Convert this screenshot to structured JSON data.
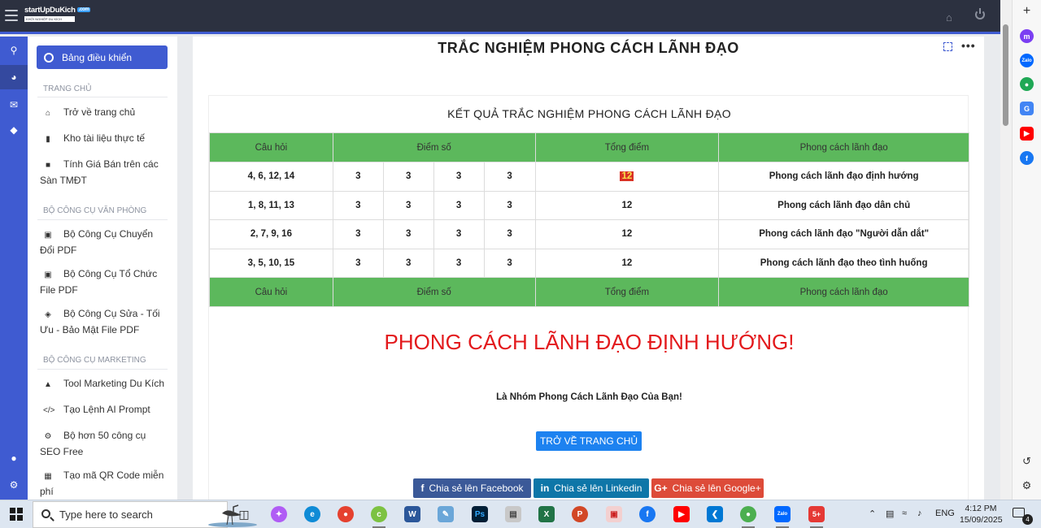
{
  "header": {
    "logo_text": "startUpDuKich",
    "logo_badge": ".com",
    "logo_tagline": "KHỞI NGHIỆP DU KÍCH"
  },
  "sidebar": {
    "dashboard_label": "Bảng điều khiển",
    "sections": [
      {
        "title": "TRANG CHỦ",
        "items": [
          {
            "label": "Trở về trang chủ",
            "icon": "home-icon"
          },
          {
            "label": "Kho tài liệu thực tế",
            "icon": "document-icon"
          },
          {
            "label": "Tính Giá Bán trên các Sàn TMĐT",
            "icon": "cart-icon"
          }
        ]
      },
      {
        "title": "BỘ CÔNG CỤ VĂN PHÒNG",
        "items": [
          {
            "label": "Bộ Công Cụ Chuyển Đổi PDF",
            "icon": "pdf-icon"
          },
          {
            "label": "Bộ Công Cụ Tổ Chức File PDF",
            "icon": "pdf-icon"
          },
          {
            "label": "Bộ Công Cụ Sửa - Tối Ưu - Bảo Mật File PDF",
            "icon": "shield-icon"
          }
        ]
      },
      {
        "title": "BỘ CÔNG CỤ MARKETING",
        "items": [
          {
            "label": "Tool Marketing Du Kích",
            "icon": "megaphone-icon"
          },
          {
            "label": "Tạo Lệnh AI Prompt",
            "icon": "code-icon"
          },
          {
            "label": "Bộ hơn 50 công cụ SEO Free",
            "icon": "gear-icon"
          },
          {
            "label": "Tạo mã QR Code miễn phí",
            "icon": "qrcode-icon"
          }
        ]
      }
    ]
  },
  "main": {
    "title": "TRẮC NGHIỆM PHONG CÁCH LÃNH ĐẠO",
    "result_title": "KẾT QUẢ TRẮC NGHIỆM PHONG CÁCH LÃNH ĐẠO",
    "table": {
      "headers": [
        "Câu hỏi",
        "Điểm số",
        "Tổng điểm",
        "Phong cách lãnh đạo"
      ],
      "rows": [
        {
          "questions": "4, 6, 12, 14",
          "scores": [
            "3",
            "3",
            "3",
            "3"
          ],
          "total": "12",
          "style": "Phong cách lãnh đạo định hướng"
        },
        {
          "questions": "1, 8, 11, 13",
          "scores": [
            "3",
            "3",
            "3",
            "3"
          ],
          "total": "12",
          "style": "Phong cách lãnh đạo dân chủ"
        },
        {
          "questions": "2, 7, 9, 16",
          "scores": [
            "3",
            "3",
            "3",
            "3"
          ],
          "total": "12",
          "style": "Phong cách lãnh đạo \"Người dẫn dắt\""
        },
        {
          "questions": "3, 5, 10, 15",
          "scores": [
            "3",
            "3",
            "3",
            "3"
          ],
          "total": "12",
          "style": "Phong cách lãnh đạo theo tình huống"
        }
      ]
    },
    "result_headline": "PHONG CÁCH LÃNH ĐẠO ĐỊNH HƯỚNG!",
    "result_sub": "Là Nhóm Phong Cách Lãnh Đạo Của Bạn!",
    "home_button": "TRỞ VỀ TRANG CHỦ",
    "share": {
      "facebook": "Chia sẻ lên Facebook",
      "linkedin": "Chia sẻ lên Linkedin",
      "google": "Chia sẻ lên Google+",
      "facebook_color": "#3b5998",
      "linkedin_color": "#0e76a8",
      "google_color": "#dd4b39"
    }
  },
  "taskbar": {
    "search_placeholder": "Type here to search",
    "language": "ENG",
    "time": "4:12 PM",
    "date": "15/09/2025",
    "notification_count": "4"
  },
  "colors": {
    "accent": "#3f5bd1",
    "table_header": "#5cb85c",
    "result_red": "#e3191c"
  }
}
